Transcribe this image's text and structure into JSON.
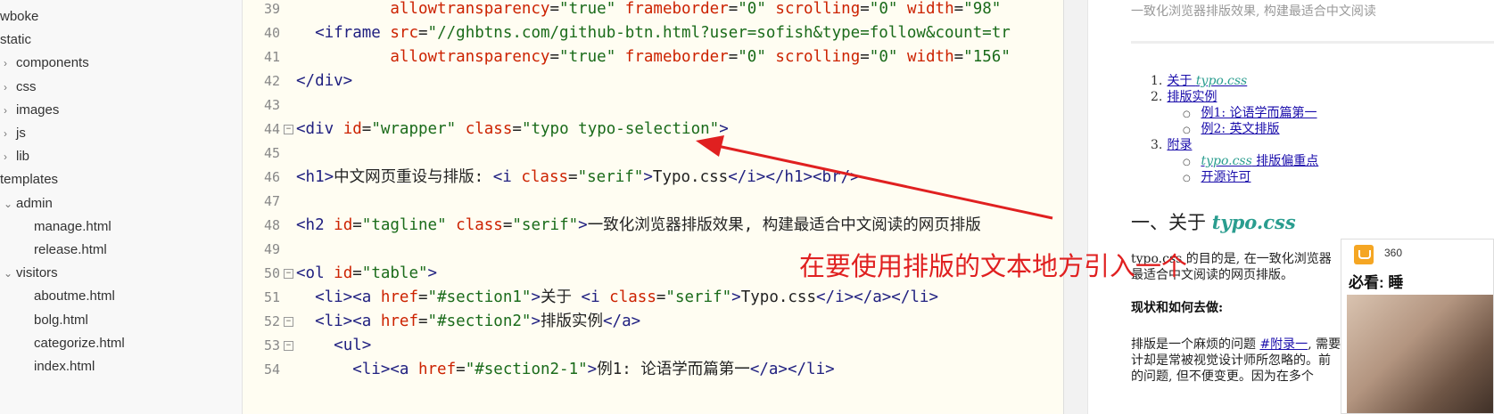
{
  "tree": [
    {
      "label": "wboke",
      "chevron": ""
    },
    {
      "label": "static",
      "chevron": ""
    },
    {
      "label": "components",
      "chevron": "›"
    },
    {
      "label": "css",
      "chevron": "›"
    },
    {
      "label": "images",
      "chevron": "›"
    },
    {
      "label": "js",
      "chevron": "›"
    },
    {
      "label": "lib",
      "chevron": "›"
    },
    {
      "label": "templates",
      "chevron": ""
    },
    {
      "label": "admin",
      "chevron": "⌄"
    },
    {
      "label": "manage.html",
      "chevron": ""
    },
    {
      "label": "release.html",
      "chevron": ""
    },
    {
      "label": "visitors",
      "chevron": "⌄"
    },
    {
      "label": "aboutme.html",
      "chevron": ""
    },
    {
      "label": "bolg.html",
      "chevron": ""
    },
    {
      "label": "categorize.html",
      "chevron": ""
    },
    {
      "label": "index.html",
      "chevron": ""
    }
  ],
  "editor": {
    "lines": [
      {
        "num": "39",
        "fold": "",
        "tokens": [
          [
            "text",
            "          "
          ],
          [
            "attr",
            "allowtransparency"
          ],
          [
            "text",
            "="
          ],
          [
            "str",
            "\"true\""
          ],
          [
            "text",
            " "
          ],
          [
            "attr",
            "frameborder"
          ],
          [
            "text",
            "="
          ],
          [
            "str",
            "\"0\""
          ],
          [
            "text",
            " "
          ],
          [
            "attr",
            "scrolling"
          ],
          [
            "text",
            "="
          ],
          [
            "str",
            "\"0\""
          ],
          [
            "text",
            " "
          ],
          [
            "attr",
            "width"
          ],
          [
            "text",
            "="
          ],
          [
            "str",
            "\"98\""
          ]
        ]
      },
      {
        "num": "40",
        "fold": "",
        "tokens": [
          [
            "text",
            "  "
          ],
          [
            "tag",
            "<iframe"
          ],
          [
            "text",
            " "
          ],
          [
            "attr",
            "src"
          ],
          [
            "text",
            "="
          ],
          [
            "str",
            "\"//ghbtns.com/github-btn.html?user=sofish&type=follow&count=tr"
          ]
        ]
      },
      {
        "num": "41",
        "fold": "",
        "tokens": [
          [
            "text",
            "          "
          ],
          [
            "attr",
            "allowtransparency"
          ],
          [
            "text",
            "="
          ],
          [
            "str",
            "\"true\""
          ],
          [
            "text",
            " "
          ],
          [
            "attr",
            "frameborder"
          ],
          [
            "text",
            "="
          ],
          [
            "str",
            "\"0\""
          ],
          [
            "text",
            " "
          ],
          [
            "attr",
            "scrolling"
          ],
          [
            "text",
            "="
          ],
          [
            "str",
            "\"0\""
          ],
          [
            "text",
            " "
          ],
          [
            "attr",
            "width"
          ],
          [
            "text",
            "="
          ],
          [
            "str",
            "\"156\""
          ]
        ]
      },
      {
        "num": "42",
        "fold": "",
        "tokens": [
          [
            "tag",
            "</div>"
          ]
        ]
      },
      {
        "num": "43",
        "fold": "",
        "tokens": []
      },
      {
        "num": "44",
        "fold": "⊟",
        "tokens": [
          [
            "tag",
            "<div"
          ],
          [
            "text",
            " "
          ],
          [
            "attr",
            "id"
          ],
          [
            "text",
            "="
          ],
          [
            "str",
            "\"wrapper\""
          ],
          [
            "text",
            " "
          ],
          [
            "attr",
            "class"
          ],
          [
            "text",
            "="
          ],
          [
            "str",
            "\"typo typo-selection\""
          ],
          [
            "tag",
            ">"
          ]
        ]
      },
      {
        "num": "45",
        "fold": "",
        "tokens": []
      },
      {
        "num": "46",
        "fold": "",
        "tokens": [
          [
            "tag",
            "<h1>"
          ],
          [
            "text",
            "中文网页重设与排版: "
          ],
          [
            "tag",
            "<i"
          ],
          [
            "text",
            " "
          ],
          [
            "attr",
            "class"
          ],
          [
            "text",
            "="
          ],
          [
            "str",
            "\"serif\""
          ],
          [
            "tag",
            ">"
          ],
          [
            "text",
            "Typo.css"
          ],
          [
            "tag",
            "</i></h1><br/>"
          ]
        ]
      },
      {
        "num": "47",
        "fold": "",
        "tokens": []
      },
      {
        "num": "48",
        "fold": "",
        "tokens": [
          [
            "tag",
            "<h2"
          ],
          [
            "text",
            " "
          ],
          [
            "attr",
            "id"
          ],
          [
            "text",
            "="
          ],
          [
            "str",
            "\"tagline\""
          ],
          [
            "text",
            " "
          ],
          [
            "attr",
            "class"
          ],
          [
            "text",
            "="
          ],
          [
            "str",
            "\"serif\""
          ],
          [
            "tag",
            ">"
          ],
          [
            "text",
            "一致化浏览器排版效果, 构建最适合中文阅读的网页排版"
          ]
        ]
      },
      {
        "num": "49",
        "fold": "",
        "tokens": []
      },
      {
        "num": "50",
        "fold": "⊟",
        "tokens": [
          [
            "tag",
            "<ol"
          ],
          [
            "text",
            " "
          ],
          [
            "attr",
            "id"
          ],
          [
            "text",
            "="
          ],
          [
            "str",
            "\"table\""
          ],
          [
            "tag",
            ">"
          ]
        ]
      },
      {
        "num": "51",
        "fold": "",
        "tokens": [
          [
            "text",
            "  "
          ],
          [
            "tag",
            "<li><a"
          ],
          [
            "text",
            " "
          ],
          [
            "attr",
            "href"
          ],
          [
            "text",
            "="
          ],
          [
            "str",
            "\"#section1\""
          ],
          [
            "tag",
            ">"
          ],
          [
            "text",
            "关于 "
          ],
          [
            "tag",
            "<i"
          ],
          [
            "text",
            " "
          ],
          [
            "attr",
            "class"
          ],
          [
            "text",
            "="
          ],
          [
            "str",
            "\"serif\""
          ],
          [
            "tag",
            ">"
          ],
          [
            "text",
            "Typo.css"
          ],
          [
            "tag",
            "</i></a></li>"
          ]
        ]
      },
      {
        "num": "52",
        "fold": "⊟",
        "tokens": [
          [
            "text",
            "  "
          ],
          [
            "tag",
            "<li><a"
          ],
          [
            "text",
            " "
          ],
          [
            "attr",
            "href"
          ],
          [
            "text",
            "="
          ],
          [
            "str",
            "\"#section2\""
          ],
          [
            "tag",
            ">"
          ],
          [
            "text",
            "排版实例"
          ],
          [
            "tag",
            "</a>"
          ]
        ]
      },
      {
        "num": "53",
        "fold": "⊟",
        "tokens": [
          [
            "text",
            "    "
          ],
          [
            "tag",
            "<ul>"
          ]
        ]
      },
      {
        "num": "54",
        "fold": "",
        "tokens": [
          [
            "text",
            "      "
          ],
          [
            "tag",
            "<li><a"
          ],
          [
            "text",
            " "
          ],
          [
            "attr",
            "href"
          ],
          [
            "text",
            "="
          ],
          [
            "str",
            "\"#section2-1\""
          ],
          [
            "tag",
            ">"
          ],
          [
            "text",
            "例1: 论语学而篇第一"
          ],
          [
            "tag",
            "</a></li>"
          ]
        ]
      }
    ]
  },
  "preview": {
    "tagline": "一致化浏览器排版效果, 构建最适合中文阅读",
    "toc": {
      "item1_num": "1.",
      "item1_text": "关于 ",
      "item1_italic": "typo.css",
      "item2_num": "2.",
      "item2_text": "排版实例",
      "sub1": "例1: 论语学而篇第一",
      "sub2": "例2: 英文排版",
      "item3_num": "3.",
      "item3_text": "附录",
      "sub3_italic": "typo.css",
      "sub3_text": " 排版偏重点",
      "sub4": "开源许可"
    },
    "h2_prefix": "一、关于 ",
    "h2_italic": "typo.css",
    "p1_line1": "typo.css 的目的是, 在一致化浏览器",
    "p1_line2": "最适合中文阅读的网页排版。",
    "h3": "现状和如何去做:",
    "p2_line1_a": "排版是一个麻烦的问题 ",
    "p2_line1_link": "#附录一",
    "p2_line1_b": ", 需要",
    "p2_line2": "计却是常被视觉设计师所忽略的。前",
    "p2_line3": "的问题, 但不便变更。因为在多个"
  },
  "popup": {
    "brand": "360",
    "title": "必看: 睡"
  },
  "annotation": {
    "note": "在要使用排版的文本地方引入一个",
    "color": "#e02020"
  }
}
